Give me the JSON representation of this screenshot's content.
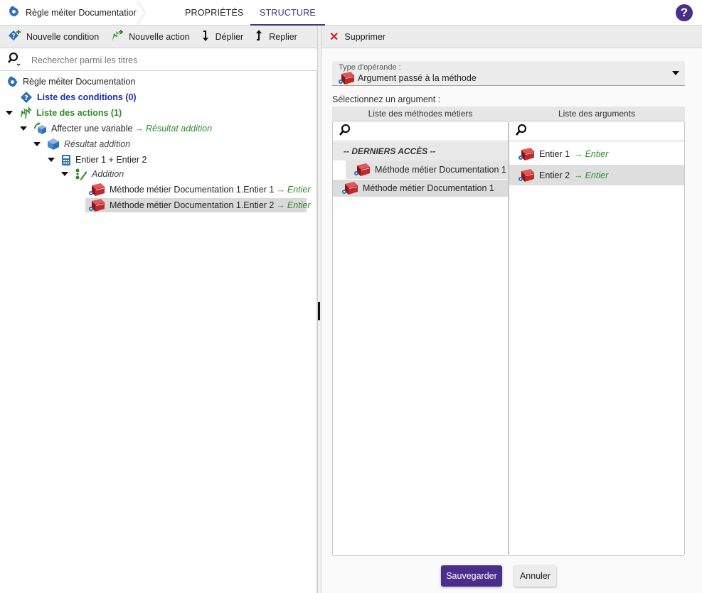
{
  "header": {
    "breadcrumb_title": "Règle méiter Documentation",
    "tabs": [
      {
        "label": "PROPRIÉTÉS",
        "active": false
      },
      {
        "label": "STRUCTURE",
        "active": true
      }
    ],
    "help_label": "?"
  },
  "left_toolbar": {
    "new_condition": "Nouvelle condition",
    "new_action": "Nouvelle action",
    "expand": "Déplier",
    "collapse": "Replier"
  },
  "left_search": {
    "placeholder": "Rechercher parmi les titres"
  },
  "tree": {
    "root": "Règle méiter Documentation",
    "conditions": "Liste des conditions (0)",
    "actions": "Liste des actions (1)",
    "assign": {
      "label": "Affecter une variable",
      "arrow": "→",
      "target": "Résultat addition"
    },
    "variable": "Résultat addition",
    "expression": "Entier 1 + Entier 2",
    "operation": "Addition",
    "operands": [
      {
        "label": "Méthode métier Documentation 1.Entier 1",
        "arrow": "→",
        "type": "Entier",
        "selected": false
      },
      {
        "label": "Méthode métier Documentation 1.Entier 2",
        "arrow": "→",
        "type": "Entier",
        "selected": true
      }
    ]
  },
  "right_toolbar": {
    "delete": "Supprimer"
  },
  "operand_type": {
    "label": "Type d'opérande :",
    "value": "Argument passé à la méthode"
  },
  "argument_section": {
    "label": "Sélectionnez un argument :"
  },
  "methods_list": {
    "header": "Liste des méthodes métiers",
    "recent_header": "-- DERNIERS ACCÈS --",
    "recent_items": [
      "Méthode métier Documentation 1"
    ],
    "items": [
      "Méthode métier Documentation 1"
    ]
  },
  "arguments_list": {
    "header": "Liste des arguments",
    "items": [
      {
        "label": "Entier 1",
        "arrow": "→",
        "type": "Entier",
        "selected": false
      },
      {
        "label": "Entier 2",
        "arrow": "→",
        "type": "Entier",
        "selected": true
      }
    ]
  },
  "buttons": {
    "save": "Sauvegarder",
    "cancel": "Annuler"
  },
  "colors": {
    "accent": "#4a2e8c",
    "tab_active": "#3a3a8c",
    "conditions": "#1a2fb5",
    "actions": "#2e8b2e",
    "delete": "#d42020",
    "book": "#c0282a",
    "gear": "#2f6db5"
  }
}
